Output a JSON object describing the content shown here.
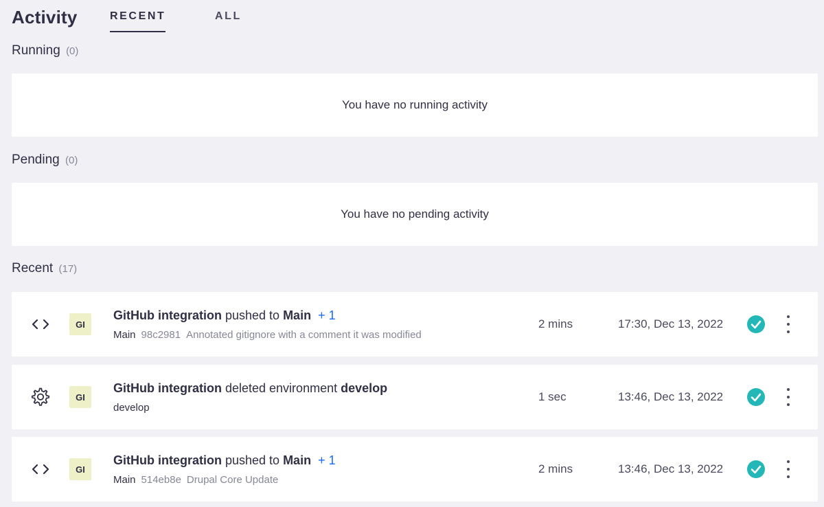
{
  "header": {
    "title": "Activity",
    "tabs": [
      {
        "label": "RECENT",
        "active": true
      },
      {
        "label": "ALL",
        "active": false
      }
    ]
  },
  "running": {
    "label": "Running",
    "count": "(0)",
    "empty_message": "You have no running activity"
  },
  "pending": {
    "label": "Pending",
    "count": "(0)",
    "empty_message": "You have no pending activity"
  },
  "recent": {
    "label": "Recent",
    "count": "(17)",
    "items": [
      {
        "icon": "code-icon",
        "avatar": "GI",
        "actor": "GitHub integration",
        "action": " pushed to ",
        "target": "Main",
        "extra": "+ 1",
        "sub_branch": "Main",
        "sub_hash": "98c2981",
        "sub_message": "Annotated gitignore with a comment it was modified",
        "duration": "2 mins",
        "timestamp": "17:30, Dec 13, 2022",
        "status": "success"
      },
      {
        "icon": "gear-icon",
        "avatar": "GI",
        "actor": "GitHub integration",
        "action": " deleted environment ",
        "target": "develop",
        "sub_branch": "develop",
        "duration": "1 sec",
        "timestamp": "13:46, Dec 13, 2022",
        "status": "success"
      },
      {
        "icon": "code-icon",
        "avatar": "GI",
        "actor": "GitHub integration",
        "action": " pushed to ",
        "target": "Main",
        "extra": "+ 1",
        "sub_branch": "Main",
        "sub_hash": "514eb8e",
        "sub_message": "Drupal Core Update",
        "duration": "2 mins",
        "timestamp": "13:46, Dec 13, 2022",
        "status": "success"
      }
    ]
  },
  "colors": {
    "background": "#f0f0f5",
    "text": "#302f45",
    "muted": "#868798",
    "link": "#1a6aff",
    "success": "#23b7b7",
    "avatar_bg": "#eef0c7"
  }
}
